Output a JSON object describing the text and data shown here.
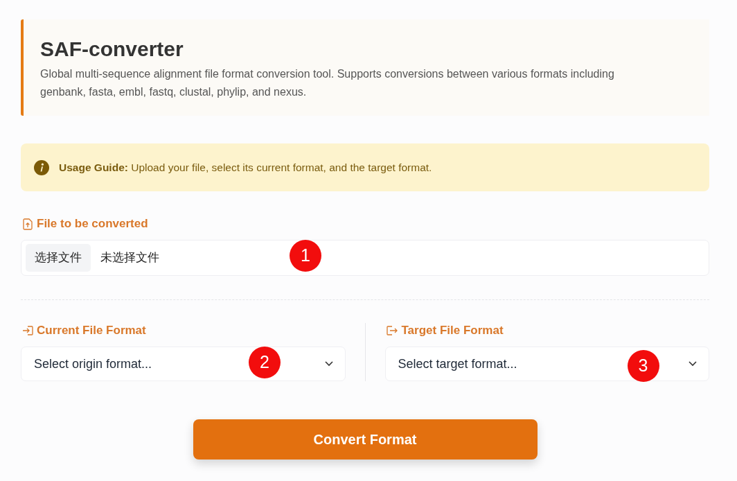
{
  "header": {
    "title": "SAF-converter",
    "description": "Global multi-sequence alignment file format conversion tool. Supports conversions between various formats including genbank, fasta, embl, fastq, clustal, phylip, and nexus."
  },
  "notice": {
    "text": "**Usage Guide:** Upload your file, select its current format, and the target format."
  },
  "file_field": {
    "label": "File to be converted",
    "button": "选择文件",
    "value": "未选择文件",
    "marker": "1"
  },
  "format_fields": [
    {
      "kind": "origin",
      "label": "Current File Format",
      "placeholder": "Select origin format...",
      "marker": "2"
    },
    {
      "kind": "target",
      "label": "Target File Format",
      "placeholder": "Select target format...",
      "marker": "3"
    }
  ],
  "convert_button": {
    "label": "Convert Format"
  }
}
